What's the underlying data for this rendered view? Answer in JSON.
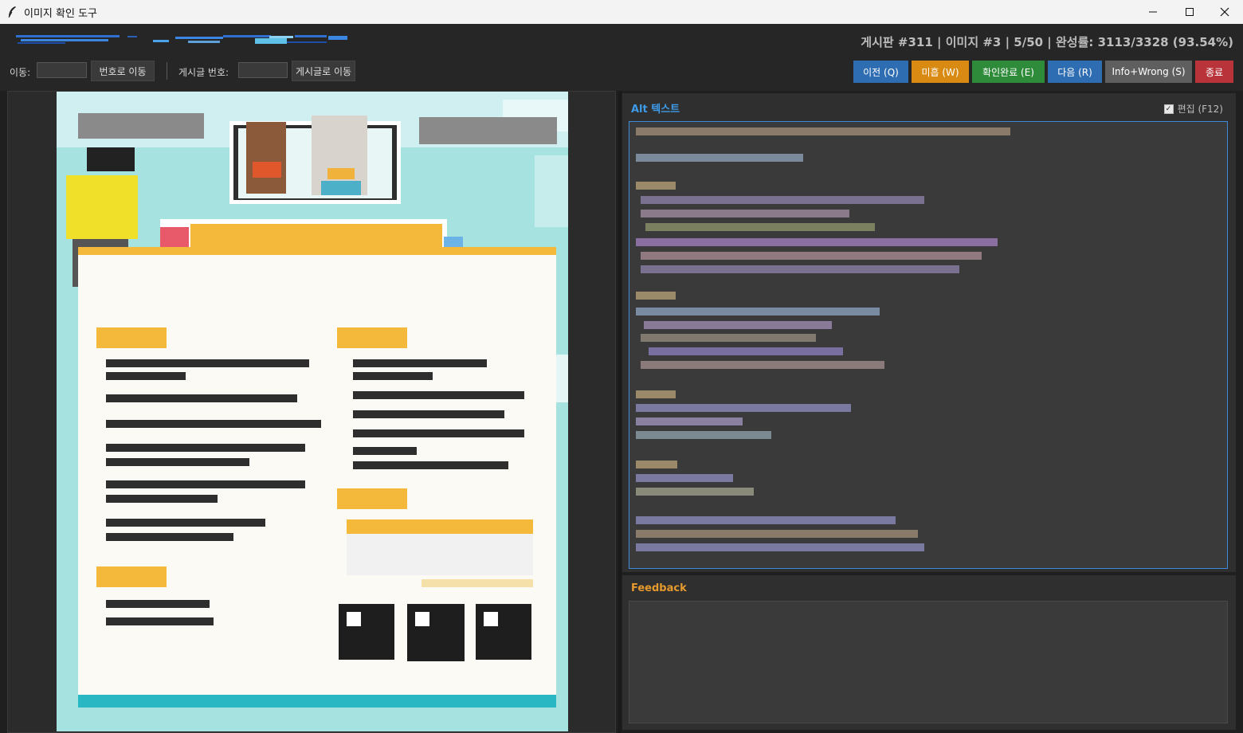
{
  "window": {
    "title": "이미지 확인 도구"
  },
  "status": {
    "text": "게시판 #311  |  이미지 #3  |  5/50  |  완성률: 3113/3328 (93.54%)"
  },
  "nav": {
    "move_label": "이동:",
    "move_value": "",
    "move_button": "번호로 이동",
    "post_label": "게시글 번호:",
    "post_value": "",
    "post_button": "게시글로 이동"
  },
  "actions": {
    "prev": "이전 (Q)",
    "pending": "미흡 (W)",
    "confirm": "확인완료 (E)",
    "next": "다음 (R)",
    "info_wrong": "Info+Wrong (S)",
    "quit": "종료"
  },
  "alt_panel": {
    "title": "Alt 텍스트",
    "edit_label": "편집 (F12)",
    "edit_checked": true
  },
  "feedback_panel": {
    "title": "Feedback",
    "value": ""
  },
  "colors": {
    "prev": "#2f6db3",
    "pending": "#d98a12",
    "confirm": "#2e8b3a",
    "next": "#2f6db3",
    "info_wrong": "#5f5f5f",
    "quit": "#b8333a",
    "alt_title": "#3d9be9",
    "feedback_title": "#e69a2e"
  },
  "icons": {
    "app": "feather-icon",
    "minimize": "minimize-icon",
    "maximize": "maximize-icon",
    "close": "close-icon"
  }
}
